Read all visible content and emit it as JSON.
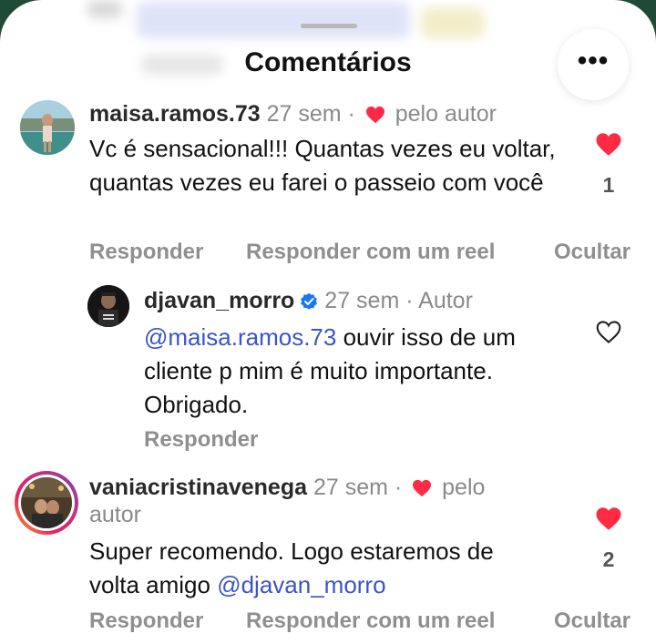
{
  "header": {
    "title": "Comentários",
    "more_label": "•••"
  },
  "colors": {
    "like_red": "#ff2b45",
    "mention_blue": "#3b54c8",
    "verified_blue": "#1877f2"
  },
  "comments": [
    {
      "username": "maisa.ramos.73",
      "time": "27 sem",
      "separator": "·",
      "liked_by_author": "pelo autor",
      "text": "Vc é sensacional!!! Quantas vezes eu voltar, quantas vezes eu farei o passeio com você",
      "like_count": "1",
      "liked": true,
      "actions": {
        "reply": "Responder",
        "reply_reel": "Responder com um reel",
        "hide": "Ocultar"
      }
    },
    {
      "username": "djavan_morro",
      "verified": true,
      "time": "27 sem",
      "separator": "·",
      "author_tag": "Autor",
      "mention": "@maisa.ramos.73",
      "text": " ouvir isso de um cliente p mim é muito importante. Obrigado.",
      "liked": false,
      "actions": {
        "reply": "Responder"
      }
    },
    {
      "username": "vaniacristinavenega",
      "time": "27 sem",
      "separator": "·",
      "liked_by_author_1": "pelo",
      "liked_by_author_2": "autor",
      "text": "Super recomendo. Logo estaremos de volta amigo ",
      "mention": "@djavan_morro",
      "like_count": "2",
      "liked": true,
      "actions": {
        "reply": "Responder",
        "reply_reel": "Responder com um reel",
        "hide": "Ocultar"
      }
    }
  ]
}
